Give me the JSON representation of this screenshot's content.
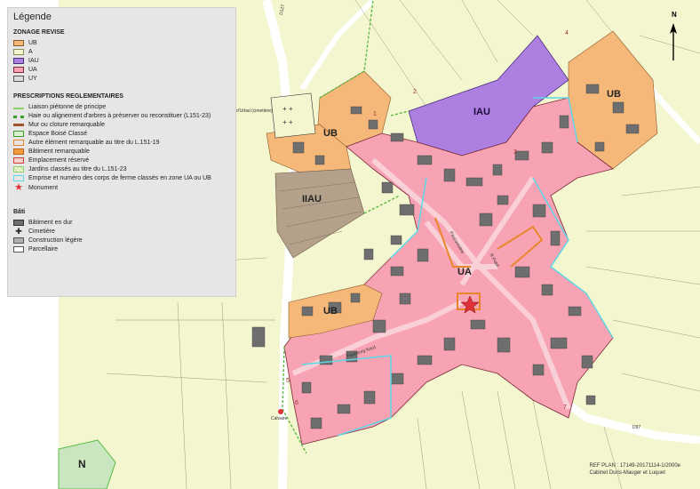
{
  "legend": {
    "title": "Légende",
    "zonage_title": "ZONAGE REVISE",
    "zones": [
      {
        "label": "UB",
        "color": "#f6b879"
      },
      {
        "label": "A",
        "color": "#f4f6cf"
      },
      {
        "label": "IAU",
        "color": "#ad7fe0"
      },
      {
        "label": "UA",
        "color": "#f7a3b3"
      },
      {
        "label": "UY",
        "color": "#dcdcdc"
      }
    ],
    "prescriptions_title": "PRESCRIPTIONS REGLEMENTAIRES",
    "prescriptions": [
      {
        "label": "Liaison piétonne de principe",
        "icon": "dashed-green-line"
      },
      {
        "label": "Haie ou alignement d'arbres à préserver ou reconstituer (L151-23)",
        "icon": "green-dots"
      },
      {
        "label": "Mur ou cloture remarquable",
        "icon": "brown-line"
      },
      {
        "label": "Espace Boisé Classé",
        "icon": "green-box"
      },
      {
        "label": "Autre élément remarquable au titre du L.151-19",
        "icon": "orange-box"
      },
      {
        "label": "Bâtiment remarquable",
        "icon": "orange-fill"
      },
      {
        "label": "Emplacement réservé",
        "icon": "red-box"
      },
      {
        "label": "Jardins classés au titre du L.151-23",
        "icon": "hatched-box"
      },
      {
        "label": "Emprise et numéro des corps de ferme classés en zone UA ou UB",
        "icon": "cyan-box"
      },
      {
        "label": "Monument",
        "icon": "star-icon"
      }
    ],
    "bati_title": "Bâti",
    "bati": [
      {
        "label": "Bâtiment en dur",
        "icon": "grey-fill"
      },
      {
        "label": "Cimetière",
        "icon": "cross-icon"
      },
      {
        "label": "Construction légère",
        "icon": "grey-light-box"
      },
      {
        "label": "Parcellaire",
        "icon": "white-box"
      }
    ]
  },
  "map": {
    "zone_labels": [
      "UB",
      "IAU",
      "UB",
      "IIAU",
      "UB",
      "UA"
    ],
    "street_labels": [
      "d'Urbal (cimetière)",
      "D127",
      "Fauconnière",
      "R.Potel",
      "Faubourg Nord",
      "D97"
    ],
    "place_labels": [
      "Calvaire",
      "N"
    ],
    "numbers": [
      "1",
      "2",
      "3",
      "4",
      "5",
      "6",
      "7"
    ]
  },
  "north_arrow": "N",
  "ref": {
    "line1": "REF PLAN : 17149-20171114-1/2000e",
    "line2": "Cabinet Duris-Mauger et Luquet"
  }
}
